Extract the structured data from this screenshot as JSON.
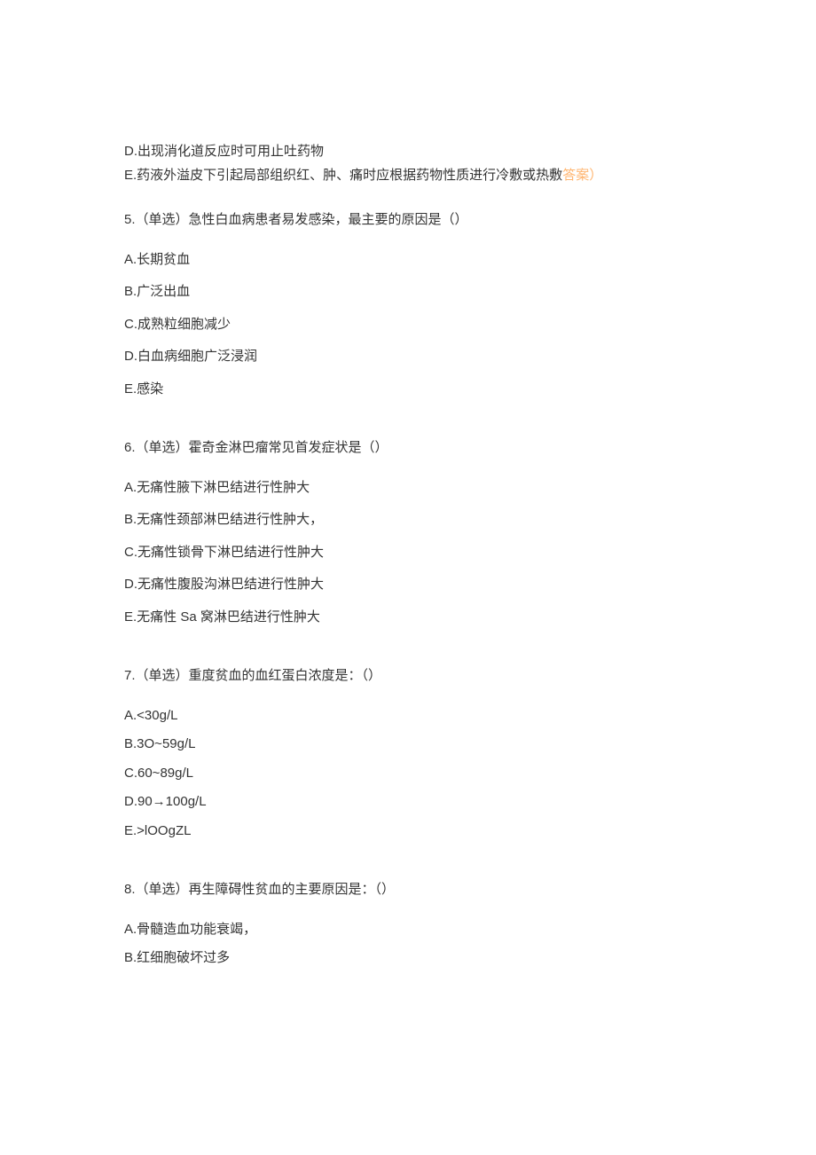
{
  "q4_tail": {
    "optD": "D.出现消化道反应时可用止吐药物",
    "optE_prefix": "E.药液外溢皮下引起局部组织红、肿、痛时应根据药物性质进行冷敷或热敷",
    "answer_tag": "答案）"
  },
  "q5": {
    "stem": "5.（单选）急性白血病患者易发感染，最主要的原因是（）",
    "A": "A.长期贫血",
    "B": "B.广泛出血",
    "C": "C.成熟粒细胞减少",
    "D": "D.白血病细胞广泛浸润",
    "E": "E.感染"
  },
  "q6": {
    "stem": "6.（单选）霍奇金淋巴瘤常见首发症状是（）",
    "A": "A.无痛性腋下淋巴结进行性肿大",
    "B": "B.无痛性颈部淋巴结进行性肿大，",
    "C": "C.无痛性锁骨下淋巴结进行性肿大",
    "D": "D.无痛性腹股沟淋巴结进行性肿大",
    "E": "E.无痛性 Sa 窝淋巴结进行性肿大"
  },
  "q7": {
    "stem": "7.（单选）重度贫血的血红蛋白浓度是：（）",
    "A": "A.<30g/L",
    "B": "B.3O~59g/L",
    "C": "C.60~89g/L",
    "D": "D.90→100g/L",
    "E": "E.>lOOgZL"
  },
  "q8": {
    "stem": "8.（单选）再生障碍性贫血的主要原因是：（）",
    "A": "A.骨髓造血功能衰竭，",
    "B": "B.红细胞破坏过多"
  }
}
